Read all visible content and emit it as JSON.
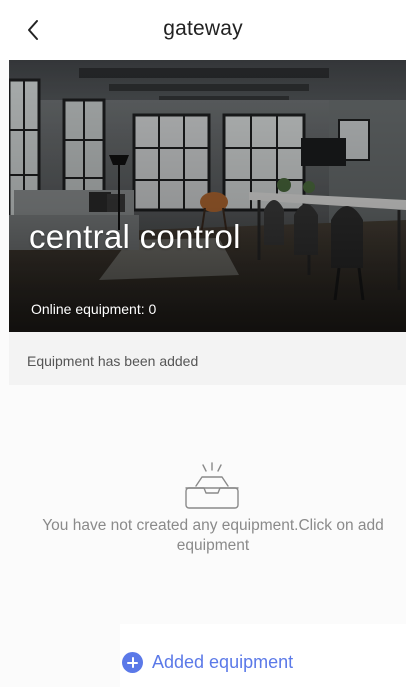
{
  "header": {
    "title": "gateway",
    "back_icon": "chevron-left-icon"
  },
  "hero": {
    "title": "central control",
    "online_text": "Online equipment: 0",
    "image_description_icon": "room-photo"
  },
  "section": {
    "label": "Equipment has been added"
  },
  "empty_state": {
    "icon": "empty-tray-icon",
    "message": "You have not created any equipment.Click on add equipment"
  },
  "add_button": {
    "icon": "plus-circle-icon",
    "label": "Added equipment",
    "color": "#5b79e8"
  }
}
